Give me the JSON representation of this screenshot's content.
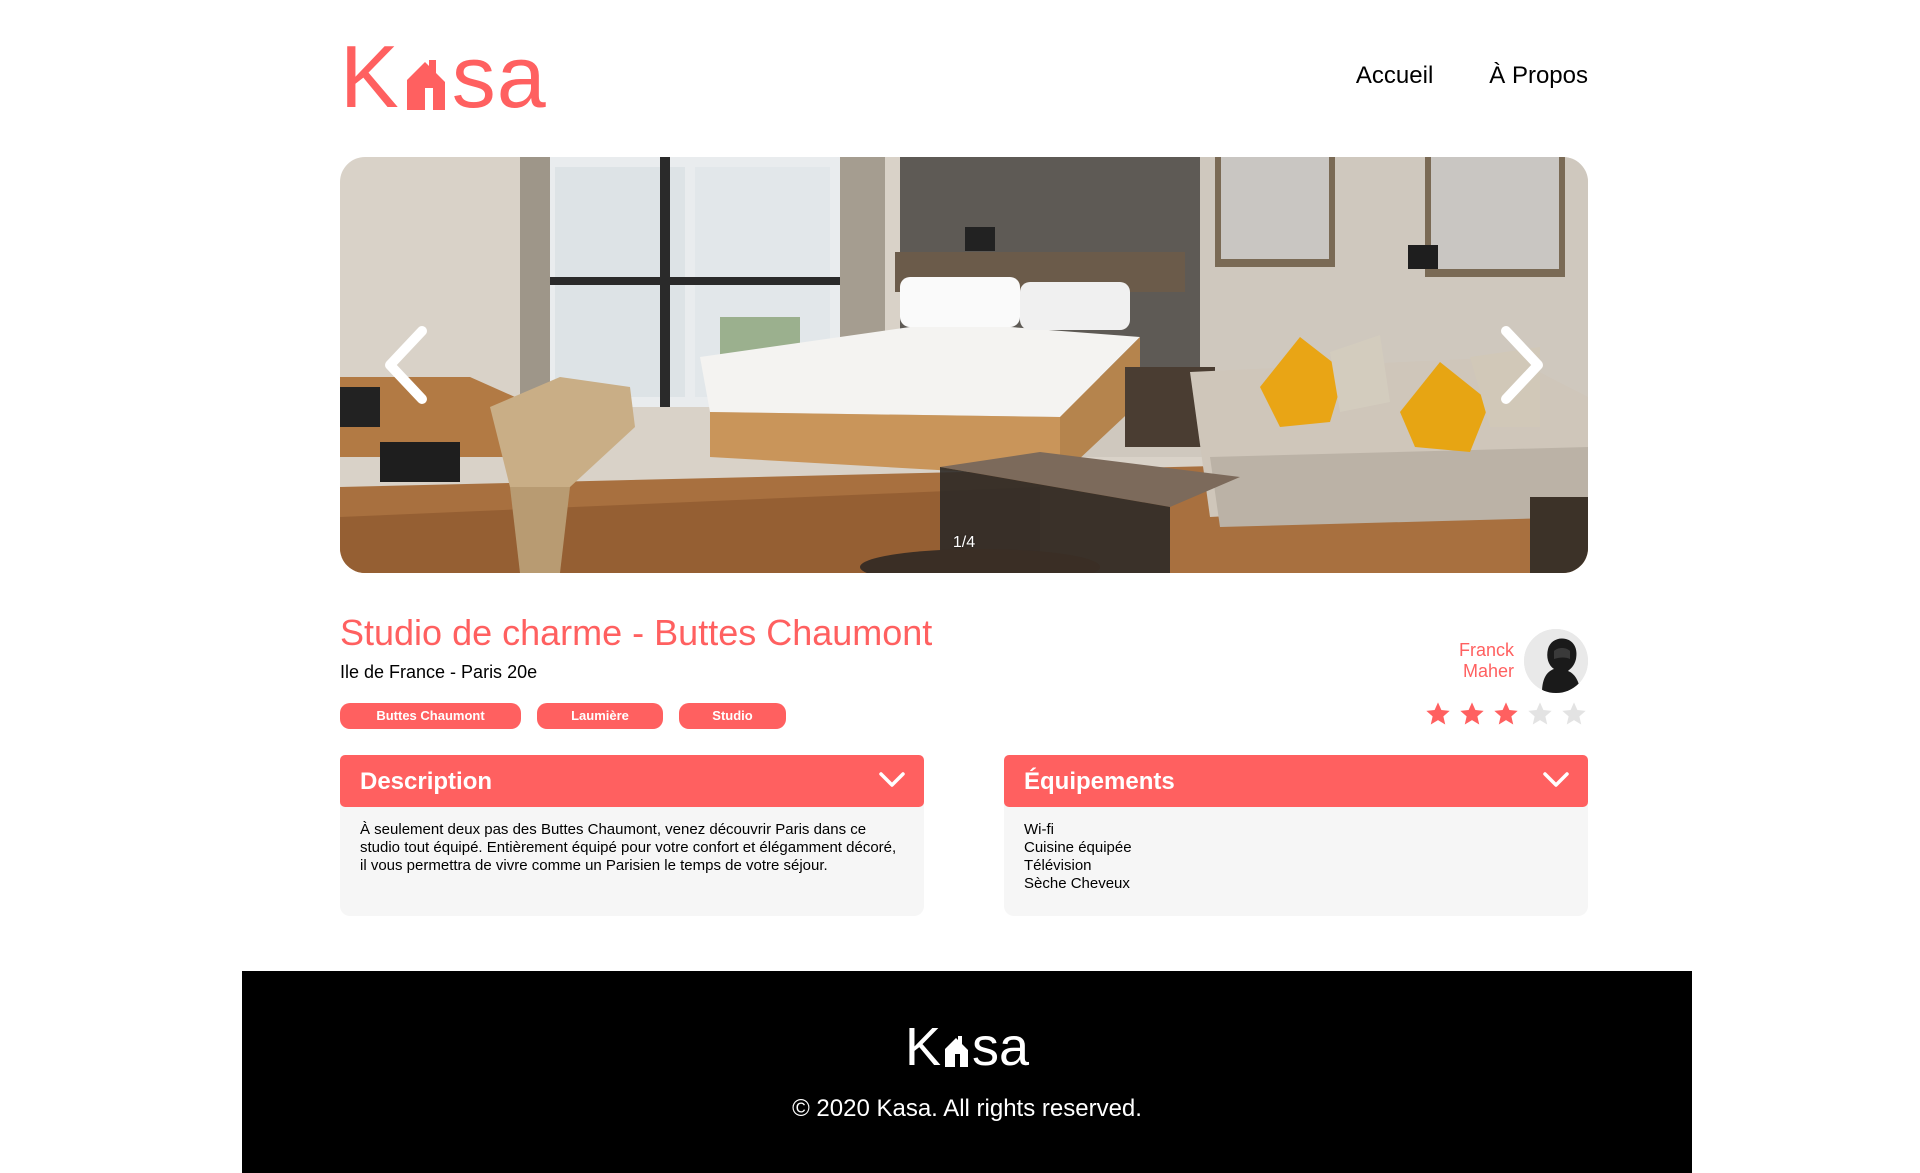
{
  "header": {
    "logo_left": "K",
    "logo_right": "sa",
    "nav": [
      {
        "label": "Accueil"
      },
      {
        "label": "À Propos"
      }
    ]
  },
  "carousel": {
    "counter": "1/4",
    "current": 1,
    "total": 4
  },
  "listing": {
    "title": "Studio de charme - Buttes Chaumont",
    "location": "Ile de France - Paris 20e",
    "tags": [
      "Buttes Chaumont",
      "Laumière",
      "Studio"
    ],
    "host": {
      "first_name": "Franck",
      "last_name": "Maher"
    },
    "rating": 3,
    "rating_max": 5
  },
  "description": {
    "label": "Description",
    "text": "À seulement deux pas des Buttes Chaumont, venez découvrir Paris dans ce studio tout équipé. Entièrement équipé pour votre confort et élégamment décoré, il vous permettra de vivre comme un Parisien le temps de votre séjour."
  },
  "equipments": {
    "label": "Équipements",
    "items": [
      "Wi-fi",
      "Cuisine équipée",
      "Télévision",
      "Sèche Cheveux"
    ]
  },
  "footer": {
    "logo_left": "K",
    "logo_right": "sa",
    "copyright": "© 2020 Kasa. All rights reserved."
  },
  "colors": {
    "accent": "#FF6060",
    "panel": "#F6F6F6",
    "footer_bg": "#000000",
    "star_empty": "#E3E3E3"
  }
}
